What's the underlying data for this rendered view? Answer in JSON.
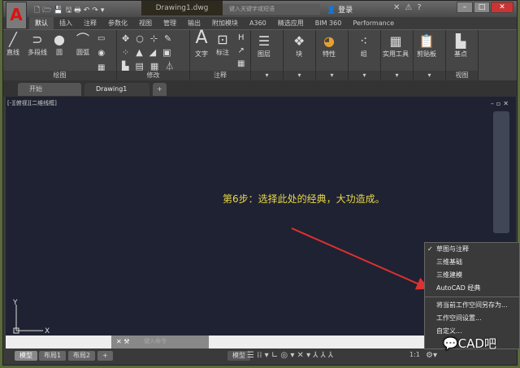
{
  "title": {
    "document": "Drawing1.dwg",
    "search_placeholder": "键入关键字或短语",
    "login": "登录"
  },
  "ribbon_tabs": [
    "默认",
    "插入",
    "注释",
    "参数化",
    "视图",
    "管理",
    "输出",
    "附加模块",
    "A360",
    "精选应用",
    "BIM 360",
    "Performance"
  ],
  "ribbon": {
    "draw": {
      "label": "绘图",
      "tools": [
        "直线",
        "多段线",
        "圆",
        "圆弧"
      ]
    },
    "modify": {
      "label": "修改"
    },
    "annotation": {
      "label": "注释",
      "tools": [
        "文字",
        "标注"
      ]
    },
    "layers": "图层",
    "block": "块",
    "properties": "特性",
    "groups": "组",
    "utilities": "实用工具",
    "clipboard": "剪贴板",
    "view": {
      "label": "视图",
      "tools": [
        "基点"
      ]
    }
  },
  "file_tabs": [
    "开始",
    "Drawing1"
  ],
  "viewport": {
    "label": "[-][俯视][二维线框]",
    "annotation": "第6步：选择此处的经典，大功造成。",
    "ucs_x": "X",
    "ucs_y": "Y"
  },
  "command": {
    "placeholder": "键入命令"
  },
  "layout_tabs": [
    "模型",
    "布局1",
    "布局2"
  ],
  "status": {
    "model": "模型",
    "scale": "1:1"
  },
  "workspace_menu": {
    "items": [
      {
        "label": "草图与注释",
        "checked": true
      },
      {
        "label": "三维基础"
      },
      {
        "label": "三维建模"
      },
      {
        "label": "AutoCAD 经典"
      }
    ],
    "actions": [
      "将当前工作空间另存为...",
      "工作空间设置...",
      "自定义..."
    ]
  },
  "watermark": "CAD吧",
  "colors": {
    "annotation": "#e8d84a",
    "arrow": "#e03030",
    "viewport_bg": "#1f2232"
  }
}
